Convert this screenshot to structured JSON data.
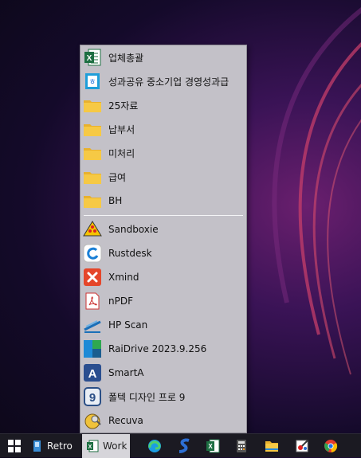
{
  "menu": {
    "items": [
      {
        "label": "업체총괄",
        "icon": "excel-icon"
      },
      {
        "label": "성과공유 중소기업 경영성과급",
        "icon": "hwp-document-icon"
      },
      {
        "label": "25자료",
        "icon": "folder-icon"
      },
      {
        "label": "납부서",
        "icon": "folder-icon"
      },
      {
        "label": "미처리",
        "icon": "folder-icon"
      },
      {
        "label": "급여",
        "icon": "folder-icon"
      },
      {
        "label": "BH",
        "icon": "folder-icon"
      },
      {
        "label": "Sandboxie",
        "icon": "sandboxie-icon"
      },
      {
        "label": "Rustdesk",
        "icon": "rustdesk-icon"
      },
      {
        "label": "Xmind",
        "icon": "xmind-icon"
      },
      {
        "label": "nPDF",
        "icon": "npdf-icon"
      },
      {
        "label": "HP Scan",
        "icon": "hp-scan-icon"
      },
      {
        "label": "RaiDrive 2023.9.256",
        "icon": "raidrive-icon"
      },
      {
        "label": "SmartA",
        "icon": "smarta-icon"
      },
      {
        "label": "폴텍 디자인 프로 9",
        "icon": "design-pro-icon"
      },
      {
        "label": "Recuva",
        "icon": "recuva-icon"
      }
    ]
  },
  "taskbar": {
    "retro_label": "Retro",
    "work_label": "Work",
    "apps": [
      "edge-icon",
      "s-app-icon",
      "excel-icon",
      "calculator-icon",
      "file-explorer-icon",
      "snipping-tool-icon",
      "chrome-icon"
    ]
  },
  "colors": {
    "menu_bg": "#c3c1c8",
    "taskbar_bg": "#1b1a22",
    "folder_yellow": "#f6c945",
    "excel_green": "#1d6f42"
  }
}
